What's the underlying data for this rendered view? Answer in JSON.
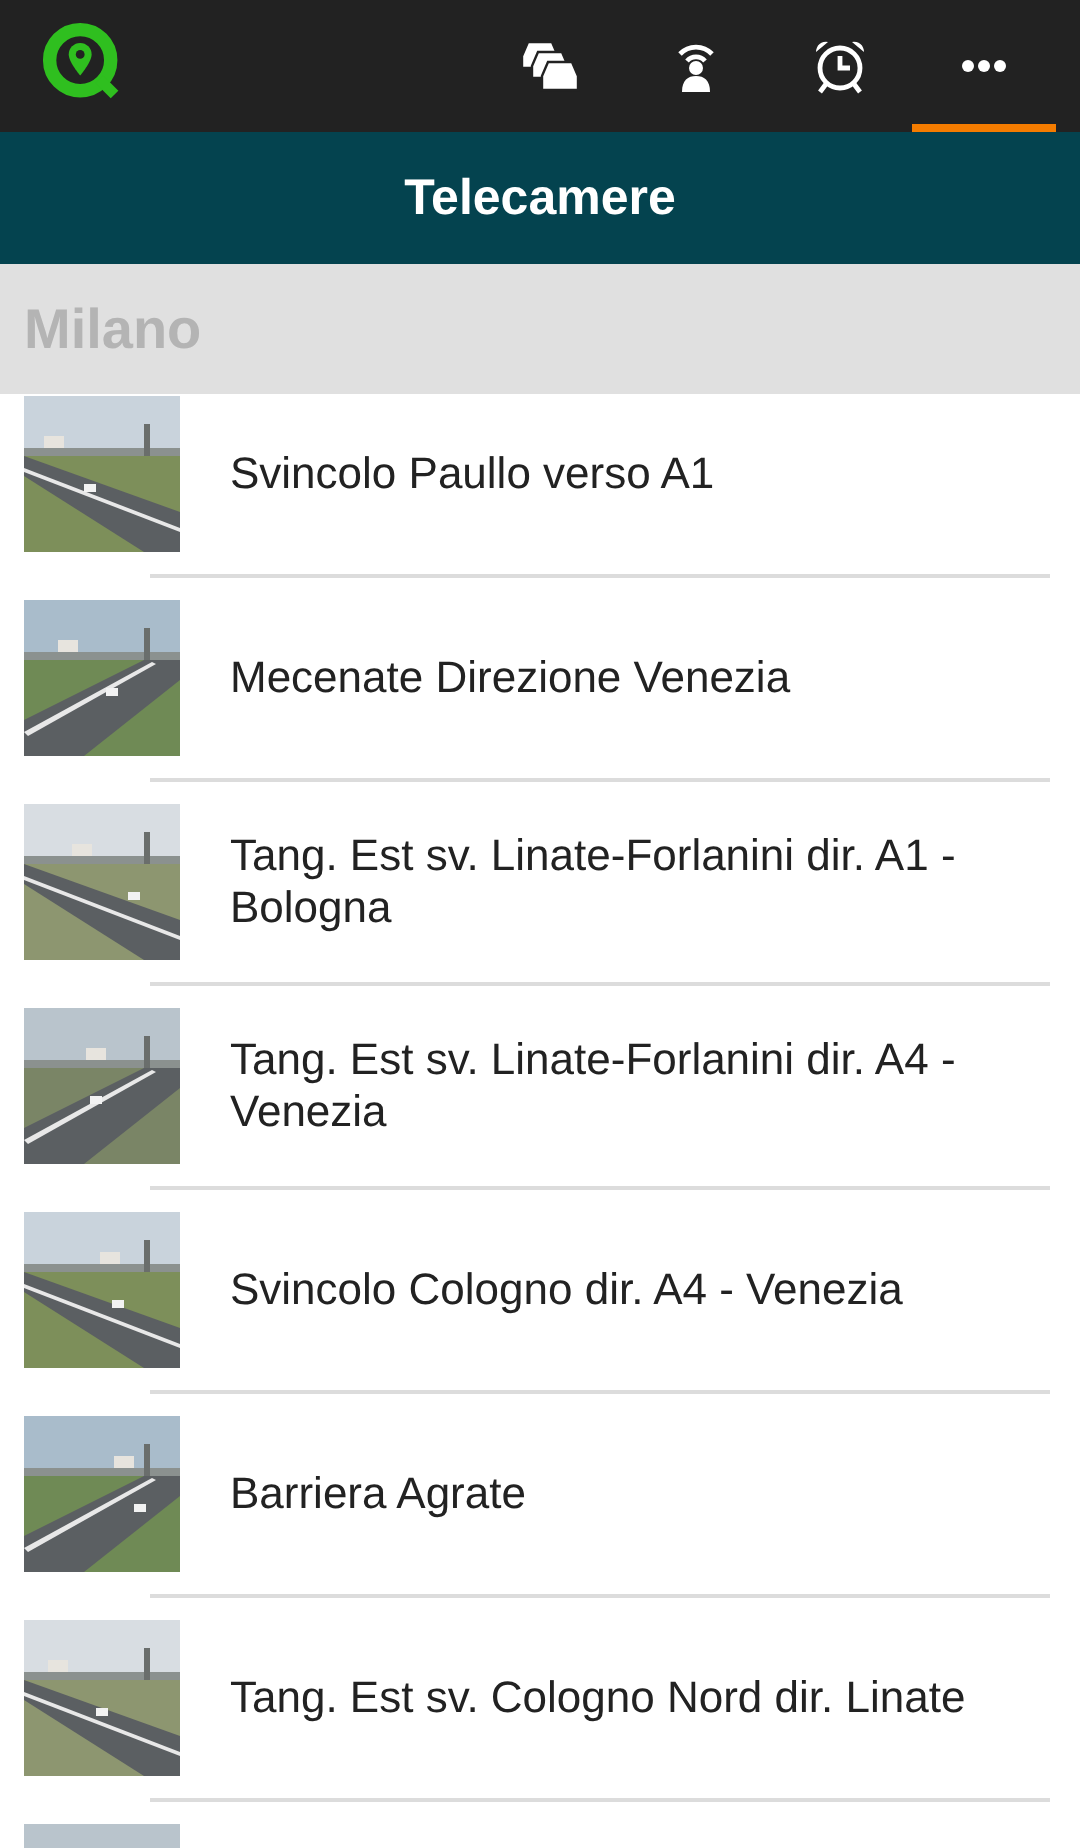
{
  "tabs": [
    {
      "kind": "traffic",
      "selected": false
    },
    {
      "kind": "broadcast",
      "selected": false
    },
    {
      "kind": "alarm",
      "selected": false
    },
    {
      "kind": "more",
      "selected": true
    }
  ],
  "title": "Telecamere",
  "section": "Milano",
  "cameras": [
    {
      "name": "Svincolo Paullo verso A1",
      "kind": "picture"
    },
    {
      "name": "Mecenate Direzione Venezia",
      "kind": "picture"
    },
    {
      "name": "Tang. Est sv. Linate-Forlanini dir. A1 - Bologna",
      "kind": "picture"
    },
    {
      "name": "Tang. Est sv. Linate-Forlanini dir. A4 - Venezia",
      "kind": "picture"
    },
    {
      "name": "Svincolo Cologno dir. A4 - Venezia",
      "kind": "picture"
    },
    {
      "name": "Barriera Agrate",
      "kind": "picture"
    },
    {
      "name": "Tang. Est sv. Cologno Nord dir. Linate",
      "kind": "picture"
    },
    {
      "kind": "picture"
    }
  ]
}
